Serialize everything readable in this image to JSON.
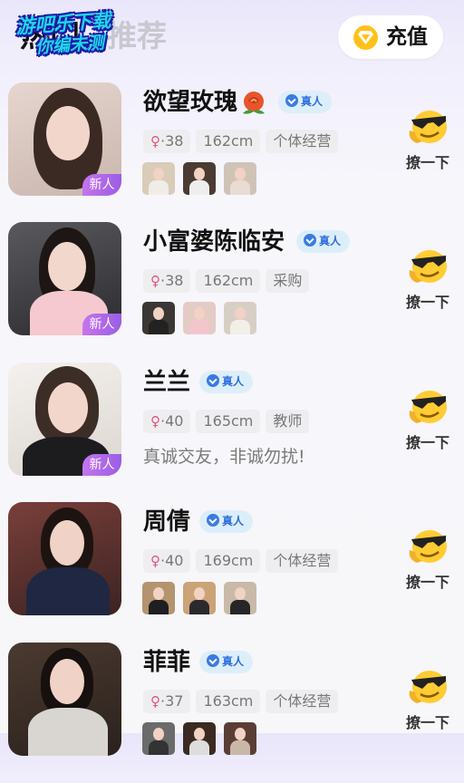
{
  "header": {
    "tabs": [
      {
        "label": "热门"
      },
      {
        "label": "推荐"
      }
    ],
    "watermark": {
      "line1": "游吧乐下载",
      "line2": "你编未测"
    },
    "recharge_label": "充值"
  },
  "users": [
    {
      "name": "欲望玫瑰",
      "has_rose": true,
      "verified_label": "真人",
      "age": "·38",
      "height": "162cm",
      "job": "个体经营",
      "new_label": "新人",
      "photos": 3,
      "bio": "",
      "action_label": "撩一下"
    },
    {
      "name": "小富婆陈临安",
      "has_rose": false,
      "verified_label": "真人",
      "age": "·38",
      "height": "162cm",
      "job": "采购",
      "new_label": "新人",
      "photos": 3,
      "bio": "",
      "action_label": "撩一下"
    },
    {
      "name": "兰兰",
      "has_rose": false,
      "verified_label": "真人",
      "age": "·40",
      "height": "165cm",
      "job": "教师",
      "new_label": "新人",
      "photos": 0,
      "bio": "真诚交友，非诚勿扰!",
      "action_label": "撩一下"
    },
    {
      "name": "周倩",
      "has_rose": false,
      "verified_label": "真人",
      "age": "·40",
      "height": "169cm",
      "job": "个体经营",
      "new_label": "",
      "photos": 3,
      "bio": "",
      "action_label": "撩一下"
    },
    {
      "name": "菲菲",
      "has_rose": false,
      "verified_label": "真人",
      "age": "·37",
      "height": "163cm",
      "job": "个体经营",
      "new_label": "",
      "photos": 3,
      "bio": "",
      "action_label": "撩一下"
    }
  ],
  "colors": {
    "verified_bg": "#ddeefb",
    "verified_text": "#2d6fdc",
    "new_badge": "#b66ae9",
    "coin": "#ffc21a",
    "gender": "#e0567d"
  },
  "icons": {
    "recharge": "diamond-coin-icon",
    "verified": "check-circle-icon",
    "gender": "female-icon",
    "action": "winking-sunglasses-emoji-icon",
    "rose": "rose-icon"
  }
}
